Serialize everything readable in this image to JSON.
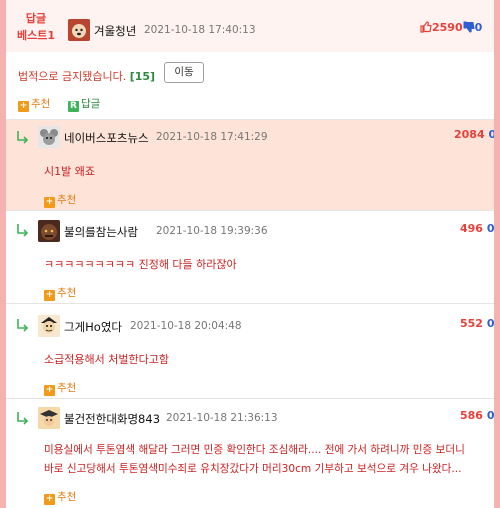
{
  "best": {
    "label_line1": "답글",
    "label_line2": "베스트1",
    "nickname": "겨울청년",
    "time": "2021-10-18 17:40:13",
    "up": "2590",
    "down": "0"
  },
  "notice": {
    "text": "법적으로 금지됐습니다.",
    "count": "[15]",
    "move_button": "이동"
  },
  "actions": {
    "recommend": "추천",
    "reply": "답글",
    "reply_icon": "R",
    "plus_icon": "+"
  },
  "comments": [
    {
      "nickname": "네이버스포츠뉴스",
      "time": "2021-10-18 17:41:29",
      "up": "2084",
      "down": "0",
      "text": "시1발 왜죠",
      "recommend": "추천"
    },
    {
      "nickname": "불의를참는사람",
      "time": "2021-10-18 19:39:36",
      "up": "496",
      "down": "0",
      "text": "ㅋㅋㅋㅋㅋㅋㅋㅋㅋ 진정해 다들 하라잖아",
      "recommend": "추천"
    },
    {
      "nickname": "그게Ho였다",
      "time": "2021-10-18 20:04:48",
      "up": "552",
      "down": "0",
      "text": "소급적용해서 처벌한다고함",
      "recommend": "추천"
    },
    {
      "nickname": "불건전한대화명843",
      "time": "2021-10-18 21:36:13",
      "up": "586",
      "down": "0",
      "text_line1": "미용실에서 투톤염색 해달라 그러면 민증 확인한다 조심해라.... 전에 가서 하려니까 민증 보더니",
      "text_line2": "바로 신고당해서 투톤염색미수죄로 유치장갔다가 머리30cm 기부하고 보석으로 겨우 나왔다...",
      "recommend": "추천"
    }
  ],
  "colors": {
    "accent_red": "#e8403a",
    "down_blue": "#2f5fd0",
    "green": "#3fb35a",
    "orange": "#f29b18",
    "highlight": "#fde3d8"
  },
  "icons": [
    "thumbs-up-icon",
    "thumbs-down-icon",
    "reply-arrow-icon",
    "plus-icon",
    "reply-r-icon"
  ]
}
